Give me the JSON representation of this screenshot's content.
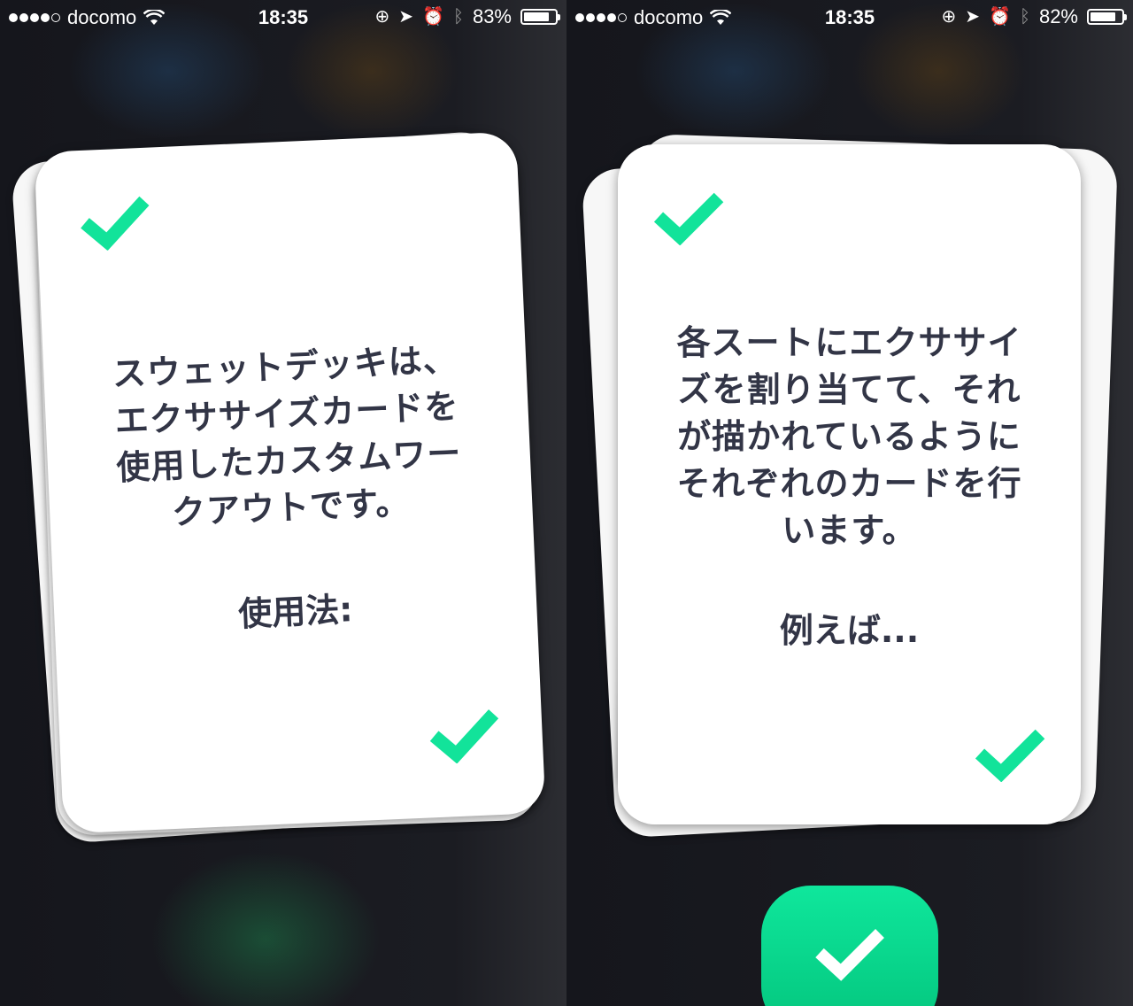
{
  "screens": [
    {
      "status": {
        "carrier": "docomo",
        "time": "18:35",
        "battery": "83%",
        "battery_level": 0.83
      },
      "card": {
        "lines": [
          "スウェットデッキは、",
          "エクササイズカードを",
          "使用したカスタムワー",
          "クアウトです。"
        ],
        "sub": "使用法:"
      }
    },
    {
      "status": {
        "carrier": "docomo",
        "time": "18:35",
        "battery": "82%",
        "battery_level": 0.82
      },
      "card": {
        "lines": [
          "各スートにエクササイ",
          "ズを割り当てて、それ",
          "が描かれているように",
          "それぞれのカードを行",
          "います。"
        ],
        "sub": "例えば..."
      }
    }
  ],
  "icons": {
    "check": "checkmark-icon",
    "wifi": "wifi-icon",
    "lock": "orientation-lock-icon",
    "location": "location-arrow-icon",
    "alarm": "alarm-icon",
    "bluetooth": "bluetooth-icon",
    "battery": "battery-icon"
  },
  "colors": {
    "accent": "#12e39a",
    "text": "#323546",
    "background": "#18191f",
    "card": "#ffffff"
  }
}
